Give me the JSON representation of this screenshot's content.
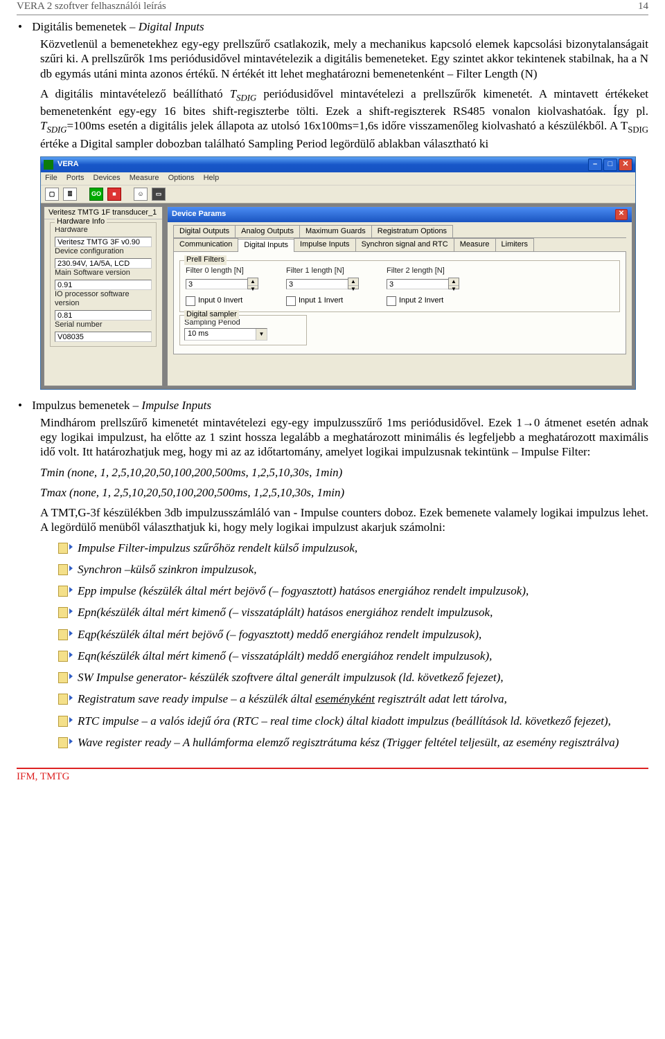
{
  "doc": {
    "header_title": "VERA 2 szoftver felhasználói leírás",
    "page_number": "14",
    "footer": "IFM, TMTG"
  },
  "bullet1": {
    "title": "Digitális bemenetek – ",
    "title_italic": "Digital Inputs",
    "para1": "Közvetlenül a bemenetekhez egy-egy prellszűrő csatlakozik, mely a mechanikus kapcsoló elemek kapcsolási bizonytalanságait szűri ki. A prellszűrők 1ms periódusidővel mintavételezik a digitális bemeneteket. Egy szintet akkor tekintenek stabilnak, ha a N db egymás utáni minta azonos értékű. N értékét itt lehet meghatározni bemenetenként – Filter Length (N)",
    "para2_before": "A digitális mintavételező beállítható ",
    "para2_tsdig": "T",
    "para2_sub": "SDIG",
    "para2_mid": " periódusidővel mintavételezi a prellszűrők kimenetét. A mintavett értékeket bemenetenként egy-egy 16 bites shift-regiszterbe tölti. Ezek a shift-regiszterek RS485 vonalon kiolvashatóak. Így pl. ",
    "para2_tsdig2": "T",
    "para2_sub2": "SDIG",
    "para2_after": "=100ms esetén a digitális jelek állapota az utolsó 16x100ms=1,6s időre visszamenőleg kiolvasható a készülékből. A T",
    "para2_sub3": "SDIG",
    "para2_end": " értéke a Digital sampler dobozban található Sampling Period legördülő ablakban választható ki"
  },
  "app": {
    "title": "VERA",
    "menu": {
      "file": "File",
      "ports": "Ports",
      "devices": "Devices",
      "measure": "Measure",
      "options": "Options",
      "help": "Help"
    },
    "toolbar": {
      "new": "▢",
      "drum": "≡",
      "go": "GO",
      "stop": "STOP",
      "people": "☺",
      "print": "▭"
    },
    "side": {
      "title": "Veritesz TMTG 1F transducer_1",
      "fs_title": "Hardware Info",
      "l_hw": "Hardware",
      "v_hw": "Veritesz TMTG 3F v0.90",
      "l_cfg": "Device configuration",
      "v_cfg": "230.94V, 1A/5A, LCD",
      "l_msw": "Main Software version",
      "v_msw": "0.91",
      "l_io": "IO processor software version",
      "v_io": "0.81",
      "l_sn": "Serial number",
      "v_sn": "V08035"
    },
    "dp": {
      "title": "Device Params",
      "tabs1": {
        "t1": "Digital Outputs",
        "t2": "Analog Outputs",
        "t3": "Maximum Guards",
        "t4": "Registratum Options"
      },
      "tabs2": {
        "t1": "Communication",
        "t2": "Digital Inputs",
        "t3": "Impulse Inputs",
        "t4": "Synchron signal and RTC",
        "t5": "Measure",
        "t6": "Limiters"
      },
      "prell_title": "Prell Filters",
      "f0_label": "Filter 0 length [N]",
      "f0_val": "3",
      "f1_label": "Filter 1 length [N]",
      "f1_val": "3",
      "f2_label": "Filter 2 length [N]",
      "f2_val": "3",
      "i0": "Input 0 Invert",
      "i1": "Input 1 Invert",
      "i2": "Input 2 Invert",
      "ds_title": "Digital sampler",
      "sp_label": "Sampling Period",
      "sp_val": "10 ms"
    }
  },
  "bullet2": {
    "title": "Impulzus bemenetek – ",
    "title_italic": "Impulse Inputs",
    "p1": "Mindhárom prellszűrő kimenetét mintavételezi egy-egy impulzusszűrő 1ms periódusidővel. Ezek 1→0 átmenet esetén adnak egy logikai impulzust, ha előtte az 1 szint hossza legalább a meghatározott minimális és legfeljebb a meghatározott maximális idő volt. Itt határozhatjuk meg, hogy mi az az időtartomány, amelyet logikai impulzusnak tekintünk – Impulse Filter:",
    "p2": "Tmin (none, 1, 2,5,10,20,50,100,200,500ms, 1,2,5,10,30s, 1min)",
    "p3": "Tmax (none, 1, 2,5,10,20,50,100,200,500ms, 1,2,5,10,30s, 1min)",
    "p4": "A TMT,G-3f készülékben 3db impulzusszámláló van - Impulse counters doboz. Ezek bemenete valamely logikai impulzus lehet. A legördülő menüből választhatjuk ki, hogy mely logikai impulzust akarjuk számolni:"
  },
  "iconlist": {
    "i1": "Impulse Filter-impulzus szűrőhöz rendelt külső impulzusok,",
    "i2": "Synchron –külső szinkron impulzusok,",
    "i3": "Epp impulse (készülék által mért bejövő (– fogyasztott) hatásos energiához rendelt impulzusok),",
    "i4": "Epn(készülék által mért kimenő (– visszatáplált) hatásos energiához rendelt impulzusok,",
    "i5": "Eqp(készülék által mért bejövő  (– fogyasztott) meddő energiához rendelt impulzusok),",
    "i6": "Eqn(készülék által mért kimenő (– visszatáplált) meddő energiához rendelt impulzusok),",
    "i7": "SW Impulse generator- készülék szoftvere által generált impulzusok (ld. következő fejezet),",
    "i8a": "Registratum save ready impulse – a készülék által ",
    "i8u": "eseményként",
    "i8b": " regisztrált adat lett tárolva,",
    "i9": "RTC impulse – a valós idejű óra (RTC – real time clock) által kiadott impulzus (beállítások ld. következő fejezet),",
    "i10": "Wave register ready – A hullámforma elemző regisztrátuma kész (Trigger feltétel teljesült, az esemény regisztrálva)"
  }
}
